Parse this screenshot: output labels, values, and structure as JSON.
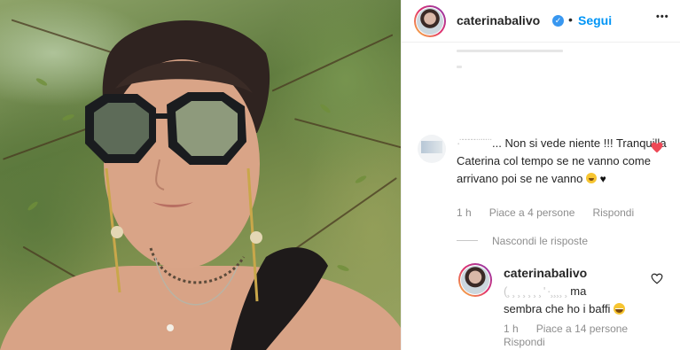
{
  "post": {
    "username": "caterinabalivo",
    "separator": "•",
    "follow_label": "Segui",
    "more_label": "•••"
  },
  "comment": {
    "redacted_name": "·¨¨¨¨¨¨ ̈  ̈ ̈ ̈ ̈",
    "text": "... Non si vede niente !!! Tranquilla Caterina col tempo se ne vanno come arrivano poi se ne vanno",
    "time": "1 h",
    "likes": "Piace a 4 persone",
    "reply_label": "Rispondi",
    "liked": true,
    "like_color": "#ed4956"
  },
  "hide_replies_label": "Nascondi le risposte",
  "reply": {
    "username": "caterinabalivo",
    "redacted_mention": "(¸ ¸ ¸ ¸ ¸ ¸ ¸ ' ·¸¸¸¸ ¸",
    "text_line1": "ma",
    "text_line2": "sembra che ho i baffi",
    "time": "1 h",
    "likes": "Piace a 14 persone",
    "reply_label": "Rispondi"
  }
}
